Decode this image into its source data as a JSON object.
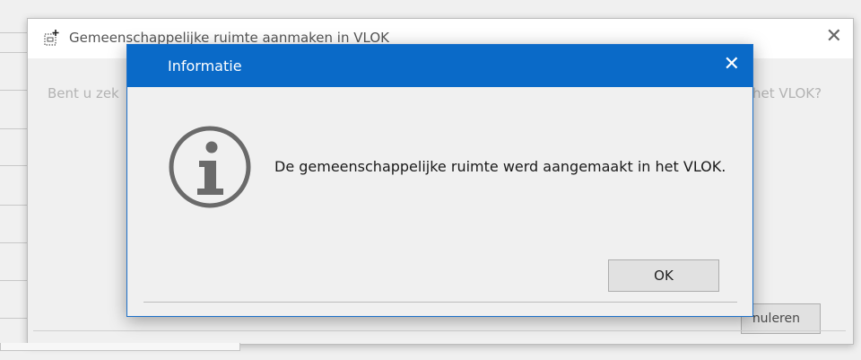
{
  "background_window": {
    "title": "Gemeenschappelijke ruimte aanmaken in VLOK",
    "question_left": "Bent u zek",
    "question_right": "het VLOK?",
    "cancel_button_label": "nuleren"
  },
  "message_dialog": {
    "title": "Informatie",
    "message": "De gemeenschappelijke ruimte werd aangemaakt in het VLOK.",
    "ok_label": "OK",
    "icon": "info-icon"
  },
  "icons": {
    "close_glyph": "✕"
  }
}
